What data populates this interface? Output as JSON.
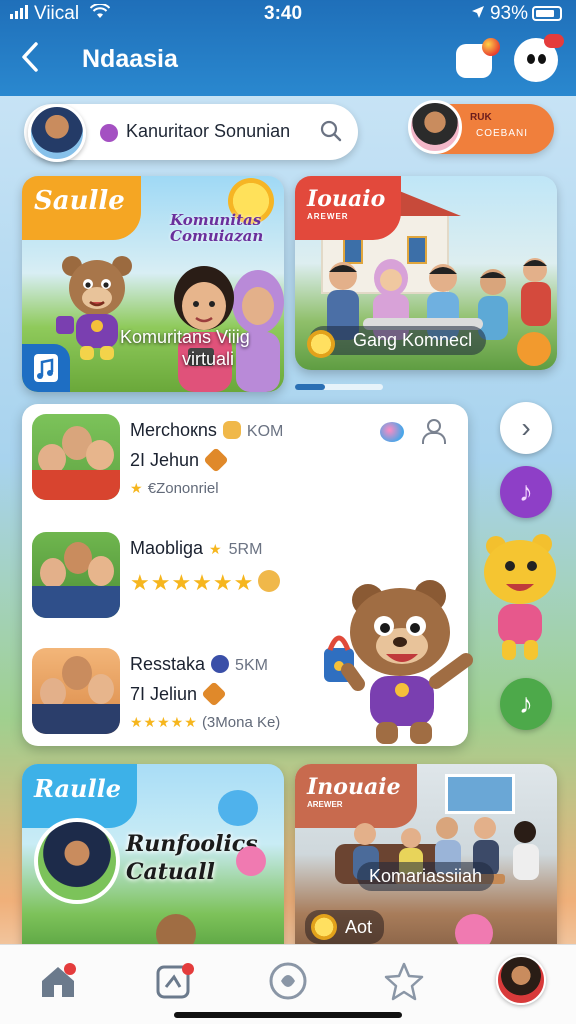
{
  "status": {
    "carrier": "Viical",
    "time": "3:40",
    "battery": "93%"
  },
  "header": {
    "title": "Ndaasia",
    "back_glyph": "‹"
  },
  "search": {
    "value": "Kanuritaor Sonunian"
  },
  "profile_pill": {
    "line1": "RUK",
    "line2": "COEBANI"
  },
  "banners": [
    {
      "tag": "Saulle",
      "overlay": "Komunitas Comuiazan",
      "caption_line1": "Komuritans Viiig",
      "caption_line2": "virtuali"
    },
    {
      "tag": "Iouaio",
      "tag_sub": "AREWER",
      "caption": "Gang Komnecl"
    }
  ],
  "list": {
    "rows": [
      {
        "name": "Merchoкns",
        "count": "KOM",
        "line2": "2I Jehun",
        "line3": "€Zononriel",
        "rating": 1
      },
      {
        "name": "Maobliga",
        "count": "5RM",
        "line2": "",
        "line3": "",
        "rating": 6
      },
      {
        "name": "Resstaka",
        "count": "5KM",
        "line2": "7I Jeliun",
        "line3": "(3Mona Ke)",
        "rating": 5
      }
    ]
  },
  "bottom_cards": [
    {
      "tag": "Raulle",
      "title_line1": "Runfoolics",
      "title_line2": "Catuall"
    },
    {
      "tag": "Inouaie",
      "tag_sub": "AREWER",
      "caption": "Komariassiiah",
      "footer": "Aot"
    }
  ],
  "side_buttons": {
    "next": "›",
    "music": "♪",
    "music2": "♪"
  },
  "tabbar": {
    "items": [
      "home",
      "apps",
      "explore",
      "favorites",
      "profile"
    ]
  },
  "colors": {
    "header": "#2a88cf",
    "accent_orange": "#f07f3c",
    "accent_purple": "#8e3fc7",
    "star": "#f6b61e"
  }
}
